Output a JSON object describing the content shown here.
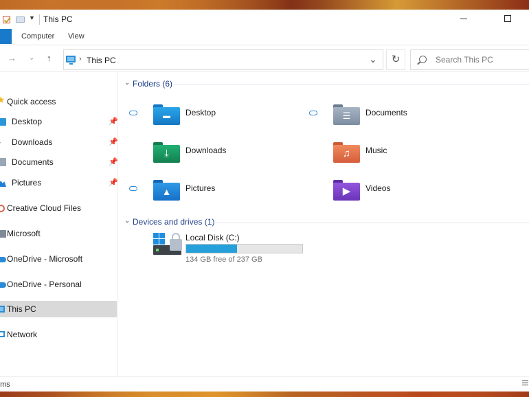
{
  "window": {
    "title": "This PC"
  },
  "ribbon": {
    "tabs": [
      "Computer",
      "View"
    ]
  },
  "address": {
    "path": "This PC",
    "search_placeholder": "Search This PC"
  },
  "sidebar": {
    "items": [
      {
        "label": "Quick access",
        "icon": "star-icon"
      },
      {
        "label": "Desktop",
        "icon": "desktop-folder-icon",
        "pinned": true
      },
      {
        "label": "Downloads",
        "icon": "downloads-folder-icon",
        "pinned": true
      },
      {
        "label": "Documents",
        "icon": "documents-folder-icon",
        "pinned": true
      },
      {
        "label": "Pictures",
        "icon": "pictures-folder-icon",
        "pinned": true
      },
      {
        "label": "Creative Cloud Files",
        "icon": "creative-cloud-icon"
      },
      {
        "label": "Microsoft",
        "icon": "microsoft-icon"
      },
      {
        "label": "OneDrive - Microsoft",
        "icon": "onedrive-icon"
      },
      {
        "label": "OneDrive - Personal",
        "icon": "onedrive-icon"
      },
      {
        "label": "This PC",
        "icon": "this-pc-icon",
        "selected": true
      },
      {
        "label": "Network",
        "icon": "network-icon"
      }
    ]
  },
  "folders": {
    "header": "Folders (6)",
    "items": [
      {
        "label": "Desktop",
        "color": "#1e8fe0",
        "cloud": true
      },
      {
        "label": "Documents",
        "color": "#8a9bb0",
        "cloud": true
      },
      {
        "label": "Downloads",
        "color": "#1c9a64",
        "cloud": false
      },
      {
        "label": "Music",
        "color": "#e8714a",
        "cloud": false
      },
      {
        "label": "Pictures",
        "color": "#1f86d8",
        "cloud": true
      },
      {
        "label": "Videos",
        "color": "#7b3fc4",
        "cloud": false
      }
    ]
  },
  "drives": {
    "header": "Devices and drives (1)",
    "items": [
      {
        "label": "Local Disk (C:)",
        "free_text": "134 GB free of 237 GB",
        "used_fraction": 0.435
      }
    ]
  },
  "statusbar": {
    "text": "ems"
  },
  "colors": {
    "accent": "#1979ca",
    "bar_fill": "#26a0da",
    "group_title": "#1e3f8a"
  }
}
